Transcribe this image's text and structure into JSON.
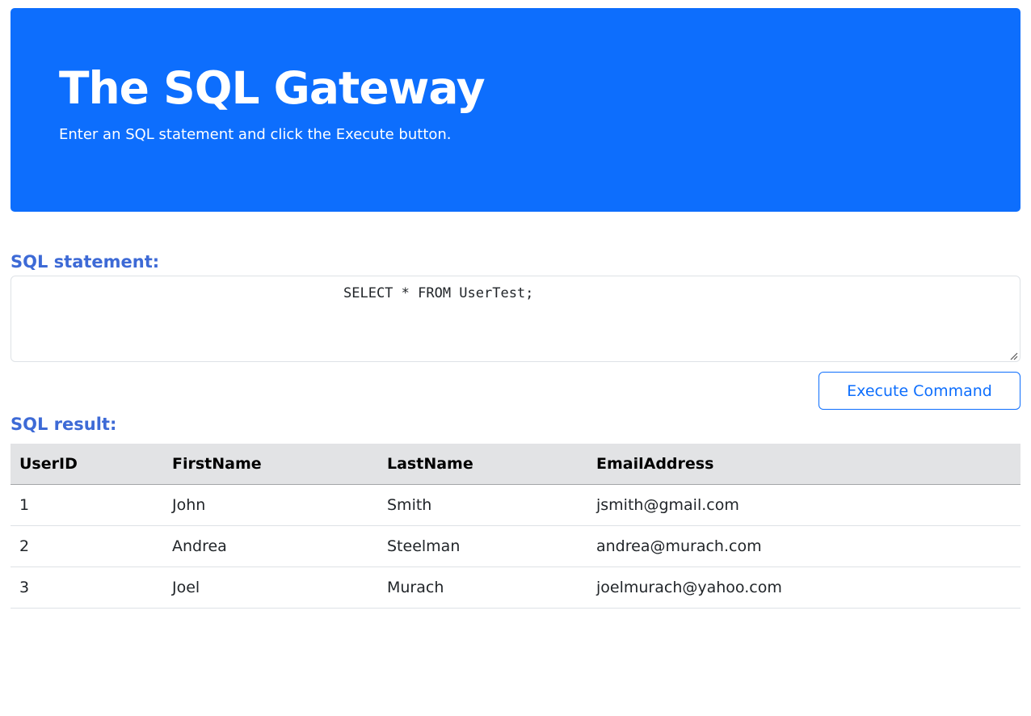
{
  "header": {
    "title": "The SQL Gateway",
    "subtitle": "Enter an SQL statement and click the Execute button."
  },
  "sql": {
    "label": "SQL statement:",
    "statement": "SELECT * FROM UserTest;"
  },
  "execute_button_label": "Execute Command",
  "result": {
    "label": "SQL result:",
    "columns": [
      "UserID",
      "FirstName",
      "LastName",
      "EmailAddress"
    ],
    "rows": [
      [
        "1",
        "John",
        "Smith",
        "jsmith@gmail.com"
      ],
      [
        "2",
        "Andrea",
        "Steelman",
        "andrea@murach.com"
      ],
      [
        "3",
        "Joel",
        "Murach",
        "joelmurach@yahoo.com"
      ]
    ]
  },
  "colors": {
    "hero_bg": "#0d6efd",
    "label": "#3d6ad6",
    "table_header_bg": "#e2e3e5"
  }
}
